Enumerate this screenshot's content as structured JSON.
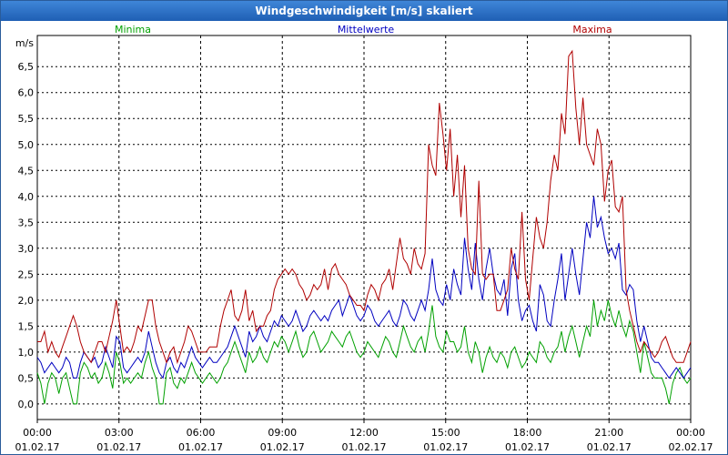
{
  "window": {
    "title": "Windgeschwindigkeit [m/s] skaliert"
  },
  "chart_data": {
    "type": "line",
    "title": "Windgeschwindigkeit [m/s] skaliert",
    "ylabel": "m/s",
    "ylim": [
      -0.3,
      7.1
    ],
    "yticks": [
      "0,0",
      "0,5",
      "1,0",
      "1,5",
      "2,0",
      "2,5",
      "3,0",
      "3,5",
      "4,0",
      "4,5",
      "5,0",
      "5,5",
      "6,0",
      "6,5"
    ],
    "yvalues": [
      0,
      0.5,
      1,
      1.5,
      2,
      2.5,
      3,
      3.5,
      4,
      4.5,
      5,
      5.5,
      6,
      6.5
    ],
    "xticks": [
      {
        "time": "00:00",
        "date": "01.02.17"
      },
      {
        "time": "03:00",
        "date": "01.02.17"
      },
      {
        "time": "06:00",
        "date": "01.02.17"
      },
      {
        "time": "09:00",
        "date": "01.02.17"
      },
      {
        "time": "12:00",
        "date": "01.02.17"
      },
      {
        "time": "15:00",
        "date": "01.02.17"
      },
      {
        "time": "18:00",
        "date": "01.02.17"
      },
      {
        "time": "21:00",
        "date": "01.02.17"
      },
      {
        "time": "00:00",
        "date": "02.02.17"
      }
    ],
    "xlim_hours": [
      0,
      24
    ],
    "grid": true,
    "legend_position": "top",
    "series": [
      {
        "name": "Minima",
        "color": "#00a000",
        "values": [
          0.6,
          0.4,
          0.0,
          0.4,
          0.6,
          0.5,
          0.2,
          0.5,
          0.6,
          0.3,
          0.0,
          0.0,
          0.6,
          0.8,
          0.7,
          0.5,
          0.6,
          0.4,
          0.5,
          0.8,
          0.6,
          0.3,
          1.0,
          0.8,
          0.4,
          0.5,
          0.4,
          0.5,
          0.6,
          0.5,
          0.8,
          1.0,
          0.7,
          0.5,
          0.0,
          0.0,
          0.6,
          0.7,
          0.4,
          0.3,
          0.5,
          0.4,
          0.6,
          0.8,
          0.6,
          0.5,
          0.4,
          0.5,
          0.6,
          0.5,
          0.4,
          0.5,
          0.7,
          0.8,
          1.0,
          1.2,
          1.0,
          0.8,
          0.6,
          1.0,
          0.8,
          0.9,
          1.1,
          0.9,
          0.8,
          1.0,
          1.2,
          1.1,
          1.3,
          1.2,
          1.0,
          1.2,
          1.4,
          1.1,
          0.9,
          1.0,
          1.3,
          1.4,
          1.2,
          1.0,
          1.1,
          1.2,
          1.4,
          1.3,
          1.2,
          1.1,
          1.3,
          1.4,
          1.2,
          1.0,
          0.9,
          1.0,
          1.2,
          1.1,
          1.0,
          0.9,
          1.1,
          1.3,
          1.2,
          1.0,
          0.9,
          1.2,
          1.5,
          1.3,
          1.1,
          1.0,
          1.2,
          1.3,
          1.0,
          1.4,
          1.9,
          1.3,
          1.1,
          1.0,
          1.4,
          1.2,
          1.2,
          1.0,
          1.1,
          1.5,
          1.0,
          0.8,
          1.2,
          1.0,
          0.6,
          0.9,
          1.1,
          0.9,
          0.8,
          1.0,
          0.9,
          0.7,
          1.0,
          1.1,
          0.9,
          0.7,
          0.8,
          1.0,
          0.9,
          0.8,
          1.2,
          1.1,
          0.9,
          0.8,
          1.0,
          1.1,
          1.4,
          1.0,
          1.3,
          1.5,
          1.2,
          0.9,
          1.2,
          1.5,
          1.3,
          2.0,
          1.5,
          1.8,
          1.6,
          2.0,
          1.7,
          1.5,
          1.8,
          1.5,
          1.3,
          1.6,
          1.4,
          1.0,
          0.6,
          1.2,
          0.9,
          0.6,
          0.5,
          0.5,
          0.5,
          0.3,
          0.0,
          0.4,
          0.6,
          0.7,
          0.5,
          0.4,
          0.5
        ]
      },
      {
        "name": "Mittelwerte",
        "color": "#0000c0",
        "values": [
          0.9,
          0.8,
          0.6,
          0.7,
          0.8,
          0.7,
          0.6,
          0.7,
          0.9,
          0.8,
          0.5,
          0.5,
          0.8,
          1.0,
          0.9,
          0.8,
          0.9,
          0.7,
          0.8,
          1.1,
          0.9,
          0.7,
          1.3,
          1.2,
          0.7,
          0.6,
          0.7,
          0.8,
          0.9,
          0.8,
          1.0,
          1.4,
          1.1,
          0.8,
          0.6,
          0.5,
          0.8,
          0.9,
          0.7,
          0.6,
          0.8,
          0.7,
          0.9,
          1.1,
          0.9,
          0.8,
          0.7,
          0.8,
          0.9,
          0.8,
          0.8,
          0.9,
          1.0,
          1.1,
          1.3,
          1.5,
          1.3,
          1.1,
          0.9,
          1.4,
          1.2,
          1.3,
          1.5,
          1.3,
          1.2,
          1.4,
          1.6,
          1.5,
          1.7,
          1.6,
          1.5,
          1.6,
          1.8,
          1.6,
          1.4,
          1.5,
          1.7,
          1.8,
          1.7,
          1.6,
          1.7,
          1.6,
          1.8,
          1.9,
          2.0,
          1.7,
          1.9,
          2.1,
          1.9,
          1.7,
          1.6,
          1.7,
          1.9,
          1.8,
          1.6,
          1.5,
          1.6,
          1.7,
          1.8,
          1.6,
          1.5,
          1.7,
          2.0,
          1.9,
          1.7,
          1.6,
          1.8,
          2.0,
          1.8,
          2.2,
          2.8,
          2.2,
          2.0,
          1.9,
          2.3,
          2.0,
          2.6,
          2.3,
          2.1,
          3.2,
          2.6,
          2.2,
          3.1,
          2.4,
          2.0,
          2.6,
          3.0,
          2.5,
          2.2,
          2.1,
          2.4,
          1.7,
          2.6,
          2.9,
          2.0,
          1.6,
          1.8,
          1.9,
          1.6,
          1.4,
          2.3,
          2.1,
          1.6,
          1.5,
          2.0,
          2.4,
          2.9,
          2.0,
          2.5,
          3.0,
          2.5,
          2.1,
          2.8,
          3.5,
          3.2,
          4.0,
          3.4,
          3.6,
          3.2,
          2.9,
          3.0,
          2.8,
          3.1,
          2.2,
          2.1,
          2.3,
          2.2,
          1.6,
          1.2,
          1.5,
          1.2,
          0.9,
          0.8,
          0.8,
          0.7,
          0.6,
          0.5,
          0.6,
          0.7,
          0.6,
          0.5,
          0.6,
          0.7
        ]
      },
      {
        "name": "Maxima",
        "color": "#b00000",
        "values": [
          1.2,
          1.2,
          1.4,
          1.0,
          1.2,
          1.0,
          0.9,
          1.1,
          1.3,
          1.5,
          1.7,
          1.5,
          1.2,
          1.0,
          0.9,
          0.8,
          1.0,
          1.2,
          1.2,
          1.0,
          1.3,
          1.6,
          2.0,
          1.5,
          1.0,
          1.1,
          1.0,
          1.2,
          1.5,
          1.4,
          1.7,
          2.0,
          2.0,
          1.5,
          1.2,
          1.0,
          0.8,
          1.0,
          1.1,
          0.8,
          1.0,
          1.2,
          1.5,
          1.4,
          1.2,
          1.0,
          1.0,
          1.0,
          1.1,
          1.1,
          1.1,
          1.5,
          1.8,
          2.0,
          2.2,
          1.7,
          1.6,
          1.8,
          2.2,
          1.6,
          1.8,
          1.4,
          1.5,
          1.5,
          1.7,
          1.8,
          2.2,
          2.4,
          2.5,
          2.6,
          2.5,
          2.6,
          2.5,
          2.3,
          2.2,
          2.0,
          2.1,
          2.3,
          2.2,
          2.3,
          2.6,
          2.2,
          2.6,
          2.7,
          2.5,
          2.4,
          2.3,
          2.1,
          2.0,
          1.9,
          1.9,
          1.8,
          2.1,
          2.3,
          2.2,
          2.0,
          2.3,
          2.4,
          2.6,
          2.2,
          2.7,
          3.2,
          2.8,
          2.7,
          2.5,
          3.0,
          2.7,
          2.6,
          2.9,
          5.0,
          4.6,
          4.4,
          5.8,
          5.2,
          4.5,
          5.3,
          4.0,
          4.8,
          3.6,
          4.6,
          3.0,
          2.6,
          2.5,
          4.3,
          2.5,
          2.4,
          2.5,
          2.5,
          1.8,
          1.8,
          2.0,
          2.2,
          3.0,
          2.6,
          2.4,
          3.7,
          2.4,
          2.0,
          2.8,
          3.6,
          3.2,
          3.0,
          3.5,
          4.3,
          4.8,
          4.5,
          5.6,
          5.2,
          6.7,
          6.8,
          5.7,
          5.0,
          5.9,
          5.0,
          4.8,
          4.6,
          5.3,
          5.0,
          3.9,
          4.5,
          4.7,
          3.8,
          3.7,
          4.0,
          2.2,
          1.8,
          1.5,
          1.2,
          1.0,
          1.2,
          1.1,
          1.0,
          0.9,
          1.0,
          1.2,
          1.3,
          1.1,
          0.9,
          0.8,
          0.8,
          0.8,
          1.0,
          1.2
        ]
      }
    ]
  }
}
